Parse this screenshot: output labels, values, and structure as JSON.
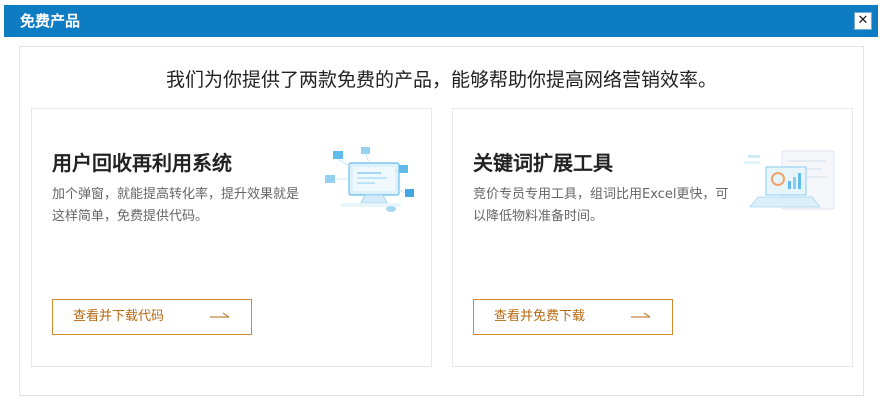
{
  "dialog": {
    "title": "免费产品",
    "close_icon": "close-icon"
  },
  "main": {
    "headline": "我们为你提供了两款免费的产品，能够帮助你提高网络营销效率。"
  },
  "cards": [
    {
      "title": "用户回收再利用系统",
      "description": "加个弹窗，就能提高转化率，提升效果就是这样简单，免费提供代码。",
      "button_label": "查看并下载代码",
      "illustration": "monitor-network-illustration",
      "arrow_icon": "right-arrow-icon"
    },
    {
      "title": "关键词扩展工具",
      "description": "竞价专员专用工具，组词比用Excel更快，可以降低物料准备时间。",
      "button_label": "查看并免费下载",
      "illustration": "laptop-chart-illustration",
      "arrow_icon": "right-arrow-icon"
    }
  ],
  "colors": {
    "titlebar": "#0e7cc3",
    "button_border": "#d08a2c",
    "button_text": "#b66a12"
  }
}
